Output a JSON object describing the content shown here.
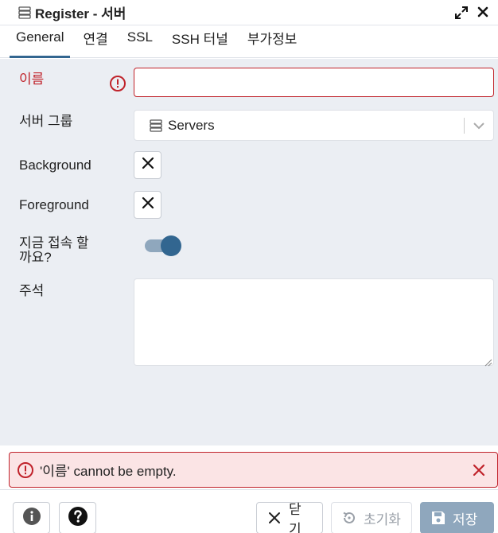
{
  "window": {
    "title": "Register - 서버",
    "title_icon": "server-icon",
    "expand_icon": "expand-icon",
    "close_icon": "close-icon"
  },
  "tabs": [
    {
      "label": "General",
      "active": true
    },
    {
      "label": "연결",
      "active": false
    },
    {
      "label": "SSL",
      "active": false
    },
    {
      "label": "SSH 터널",
      "active": false
    },
    {
      "label": "부가정보",
      "active": false
    }
  ],
  "form": {
    "name": {
      "label": "이름",
      "value": "",
      "error_icon": "alert-circle-icon"
    },
    "server_group": {
      "label": "서버 그룹",
      "value": "Servers",
      "icon": "server-icon"
    },
    "background": {
      "label": "Background",
      "icon": "x-icon"
    },
    "foreground": {
      "label": "Foreground",
      "icon": "x-icon"
    },
    "connect_now": {
      "label": "지금 접속 할까요?",
      "label_line1": "지금 접속 할",
      "label_line2": "까요?",
      "enabled": true
    },
    "comment": {
      "label": "주석",
      "value": ""
    }
  },
  "error_banner": {
    "message": "'이름' cannot be empty.",
    "icon": "alert-circle-icon",
    "close_icon": "x-icon"
  },
  "footer": {
    "info_icon": "info-icon",
    "help_icon": "help-icon",
    "close_label": "닫기",
    "reset_label": "초기화",
    "save_label": "저장"
  },
  "colors": {
    "accent": "#326690",
    "error": "#c0222a",
    "error_bg": "#fbe4e5",
    "form_bg": "#ebeef3",
    "save_disabled": "#8fa7bd"
  }
}
